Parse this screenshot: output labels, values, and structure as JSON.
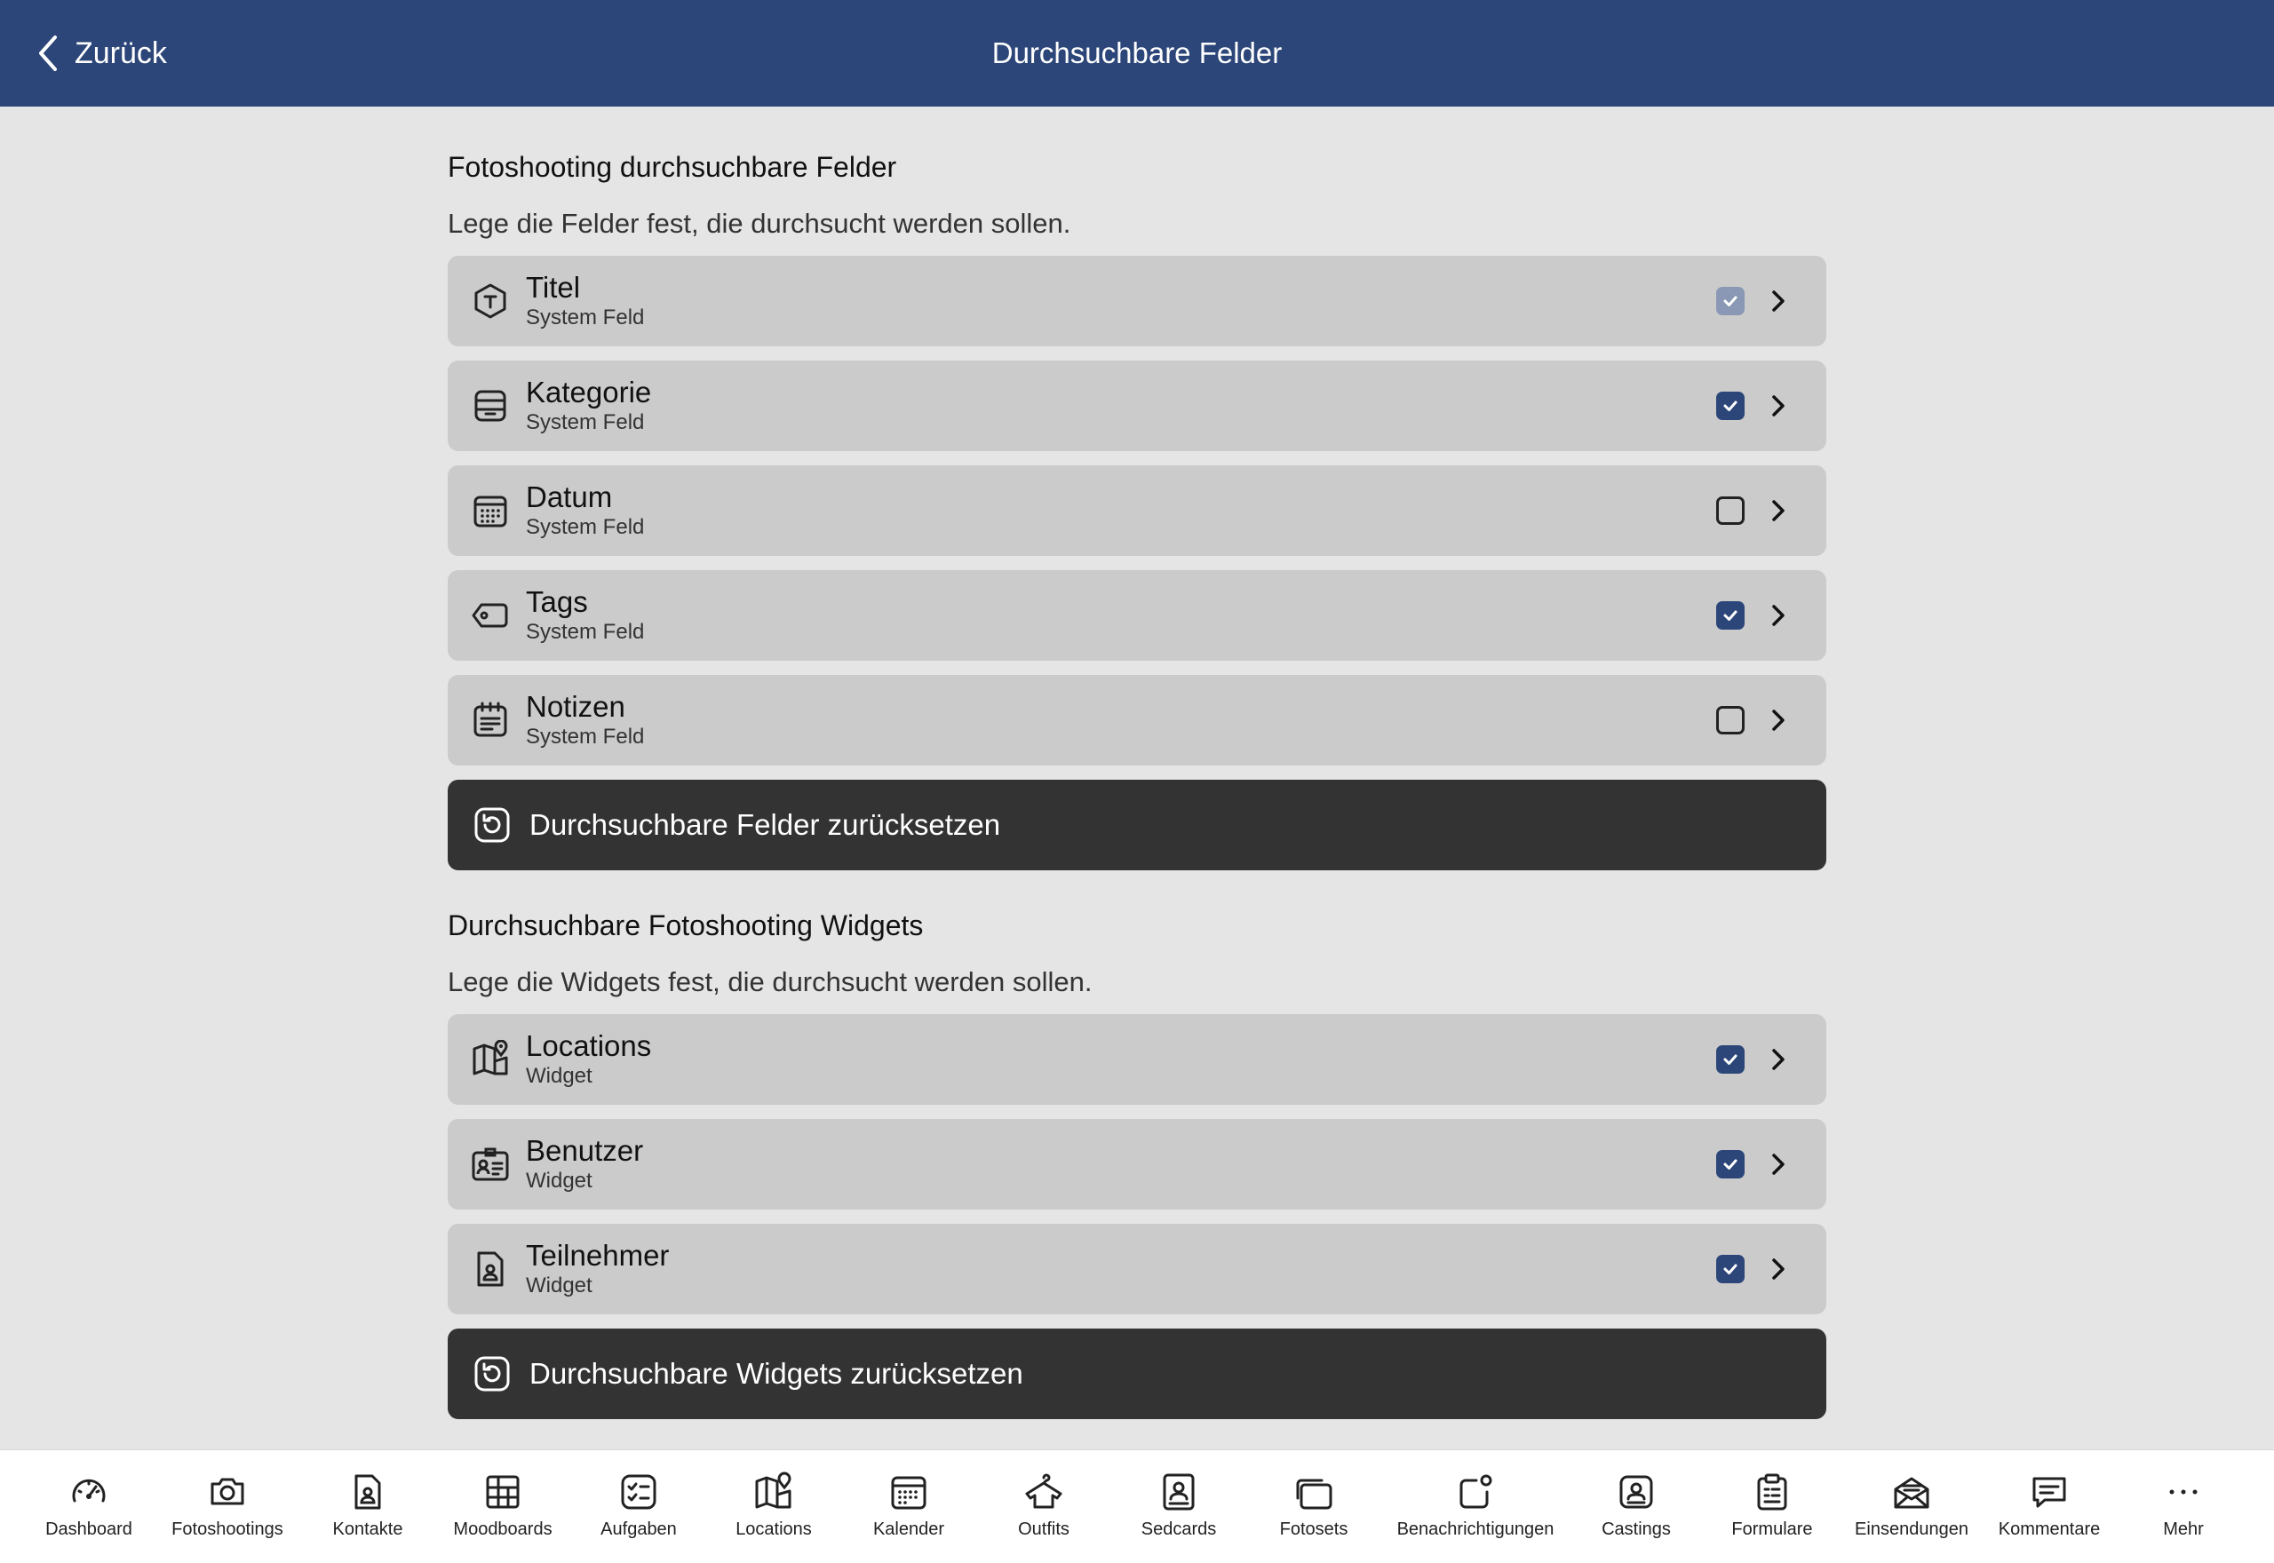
{
  "header": {
    "back_label": "Zurück",
    "title": "Durchsuchbare Felder"
  },
  "fields_section": {
    "title": "Fotoshooting durchsuchbare Felder",
    "description": "Lege die Felder fest, die durchsucht werden sollen.",
    "items": [
      {
        "label": "Titel",
        "sub": "System Feld",
        "icon": "title-tag-icon",
        "state": "checked-disabled"
      },
      {
        "label": "Kategorie",
        "sub": "System Feld",
        "icon": "category-tray-icon",
        "state": "checked"
      },
      {
        "label": "Datum",
        "sub": "System Feld",
        "icon": "calendar-icon",
        "state": "unchecked"
      },
      {
        "label": "Tags",
        "sub": "System Feld",
        "icon": "tag-icon",
        "state": "checked"
      },
      {
        "label": "Notizen",
        "sub": "System Feld",
        "icon": "notes-icon",
        "state": "unchecked"
      }
    ],
    "reset_label": "Durchsuchbare Felder zurücksetzen"
  },
  "widgets_section": {
    "title": "Durchsuchbare Fotoshooting Widgets",
    "description": "Lege die Widgets fest, die durchsucht werden sollen.",
    "items": [
      {
        "label": "Locations",
        "sub": "Widget",
        "icon": "map-pin-icon",
        "state": "checked"
      },
      {
        "label": "Benutzer",
        "sub": "Widget",
        "icon": "user-card-icon",
        "state": "checked"
      },
      {
        "label": "Teilnehmer",
        "sub": "Widget",
        "icon": "participant-file-icon",
        "state": "checked"
      }
    ],
    "reset_label": "Durchsuchbare Widgets zurücksetzen"
  },
  "tabbar": {
    "items": [
      {
        "label": "Dashboard",
        "icon": "speedometer-icon"
      },
      {
        "label": "Fotoshootings",
        "icon": "camera-icon"
      },
      {
        "label": "Kontakte",
        "icon": "contact-file-icon"
      },
      {
        "label": "Moodboards",
        "icon": "moodboard-grid-icon"
      },
      {
        "label": "Aufgaben",
        "icon": "checklist-icon"
      },
      {
        "label": "Locations",
        "icon": "map-pin-icon"
      },
      {
        "label": "Kalender",
        "icon": "calendar-icon"
      },
      {
        "label": "Outfits",
        "icon": "shirt-icon"
      },
      {
        "label": "Sedcards",
        "icon": "sedcard-icon"
      },
      {
        "label": "Fotosets",
        "icon": "photo-stack-icon"
      },
      {
        "label": "Benachrichtigungen",
        "icon": "notification-icon"
      },
      {
        "label": "Castings",
        "icon": "casting-icon"
      },
      {
        "label": "Formulare",
        "icon": "clipboard-icon"
      },
      {
        "label": "Einsendungen",
        "icon": "envelope-icon"
      },
      {
        "label": "Kommentare",
        "icon": "comment-icon"
      },
      {
        "label": "Mehr",
        "icon": "more-dots-icon"
      }
    ]
  },
  "colors": {
    "primary": "#2c4679",
    "row_bg": "#cbcbcb",
    "reset_bg": "#333333",
    "page_bg": "#e5e5e5"
  }
}
